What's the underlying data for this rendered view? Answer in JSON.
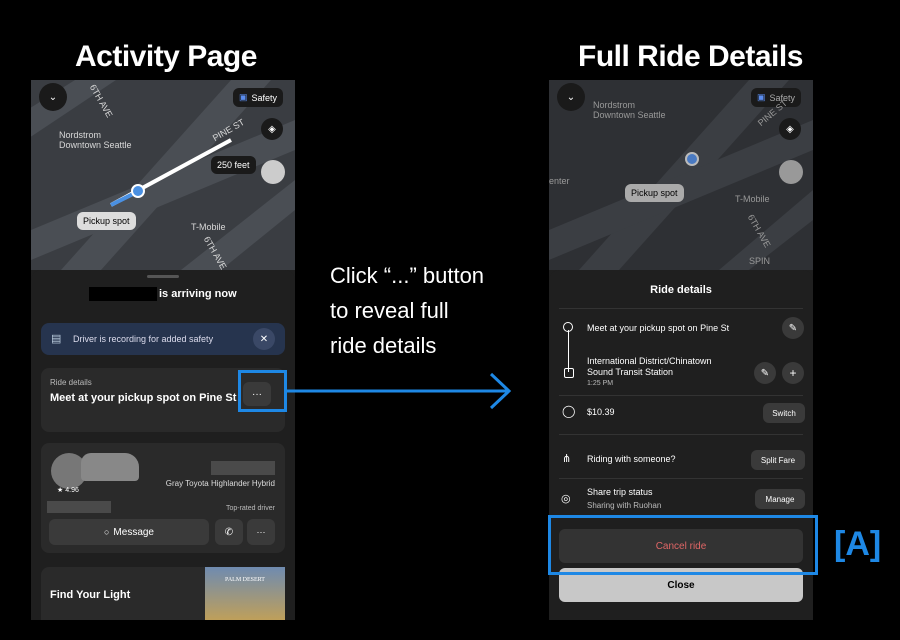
{
  "left": {
    "heading": "Activity Page",
    "map": {
      "safety": "Safety",
      "street1": "6TH AVE",
      "street2": "PINE ST",
      "street3": "6TH AVE",
      "place1": "Nordstrom",
      "place1b": "Downtown Seattle",
      "place2": "T-Mobile",
      "distance": "250 feet",
      "pickup": "Pickup spot"
    },
    "arriving": "is arriving now",
    "recording": "Driver is recording for added safety",
    "ride_details_label": "Ride details",
    "ride_details_title": "Meet at your pickup spot on Pine St",
    "more": "···",
    "rating": "4.96",
    "car": "Gray Toyota Highlander Hybrid",
    "top_rated": "Top-rated driver",
    "message": "Message",
    "find": "Find Your Light",
    "promo_brand": "PALM DESERT"
  },
  "annotation": {
    "line1": "Click “...” button",
    "line2": "to reveal full",
    "line3": "ride details"
  },
  "right": {
    "heading": "Full Ride Details",
    "map": {
      "safety": "Safety",
      "place1": "Nordstrom",
      "place1b": "Downtown Seattle",
      "street": "PINE ST",
      "place2": "T-Mobile",
      "street2": "6TH AVE",
      "pickup": "Pickup spot",
      "enter": "enter",
      "spin": "SPIN"
    },
    "title": "Ride details",
    "pickup_row": "Meet at your pickup spot on Pine St",
    "dest_row1": "International District/Chinatown",
    "dest_row2": "Sound Transit Station",
    "dest_time": "1:25 PM",
    "fare": "$10.39",
    "switch": "Switch",
    "riding_with": "Riding with someone?",
    "split_fare": "Split Fare",
    "share_status": "Share trip status",
    "sharing_with": "Sharing with Ruohan",
    "manage": "Manage",
    "cancel": "Cancel ride",
    "close": "Close"
  },
  "label_a": "[A]",
  "colors": {
    "accent": "#1e88e5",
    "cancel_text": "#e06666"
  }
}
